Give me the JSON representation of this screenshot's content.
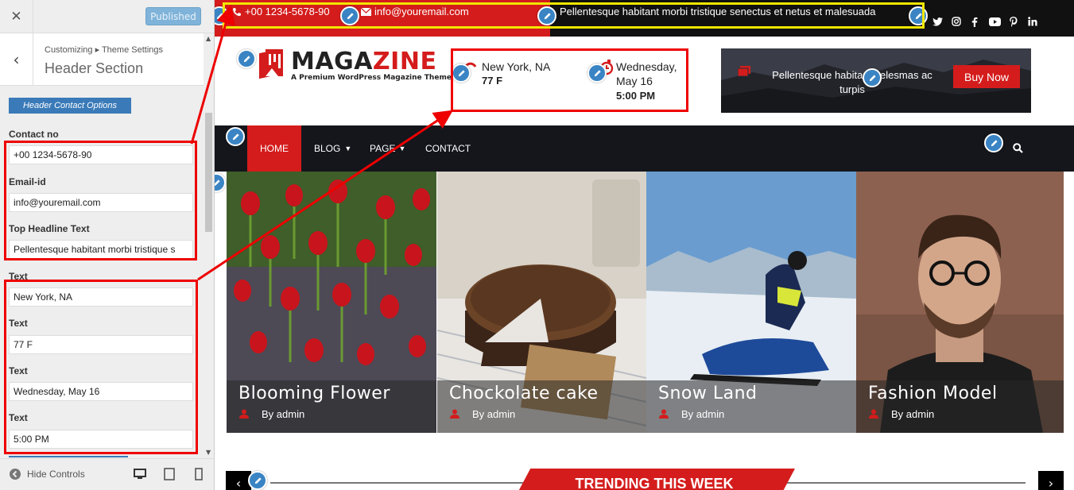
{
  "customizer": {
    "close_icon": "close-icon",
    "publish_label": "Published",
    "breadcrumb": "Customizing ▸ Theme Settings",
    "section_title": "Header Section",
    "section_button": "Header Contact Options",
    "fields": {
      "contact_label": "Contact no",
      "contact_value": "+00 1234-5678-90",
      "email_label": "Email-id",
      "email_value": "info@youremail.com",
      "headline_label": "Top Headline Text",
      "headline_value": "Pellentesque habitant morbi tristique s",
      "text1_label": "Text",
      "text1_value": "New York, NA",
      "text2_label": "Text",
      "text2_value": "77 F",
      "text3_label": "Text",
      "text3_value": "Wednesday, May 16",
      "text4_label": "Text",
      "text4_value": "5:00 PM"
    },
    "hide_controls": "Hide Controls"
  },
  "site": {
    "topbar": {
      "phone": "+00 1234-5678-90",
      "email": "info@youremail.com",
      "headline": "Pellentesque habitant morbi tristique senectus et netus et malesuada"
    },
    "logo": {
      "word_black": "MAGA",
      "word_red": "ZINE",
      "tagline": "A Premium WordPress Magazine Theme"
    },
    "location": "New York, NA",
    "temperature": "77 F",
    "date": "Wednesday, May 16",
    "time": "5:00 PM",
    "ad": {
      "text": "Pellentesque habitant helesmas ac turpis",
      "button": "Buy Now"
    },
    "nav": [
      "HOME",
      "BLOG",
      "PAGE",
      "CONTACT"
    ],
    "cards": [
      {
        "title": "Blooming Flower",
        "author": "By admin"
      },
      {
        "title": "Chockolate cake",
        "author": "By admin"
      },
      {
        "title": "Snow Land",
        "author": "By admin"
      },
      {
        "title": "Fashion Model",
        "author": "By admin"
      }
    ],
    "trending": "TRENDING THIS WEEK"
  },
  "colors": {
    "brand_red": "#d41c1c",
    "accent_blue": "#3a84c4",
    "dark": "#14161c"
  }
}
